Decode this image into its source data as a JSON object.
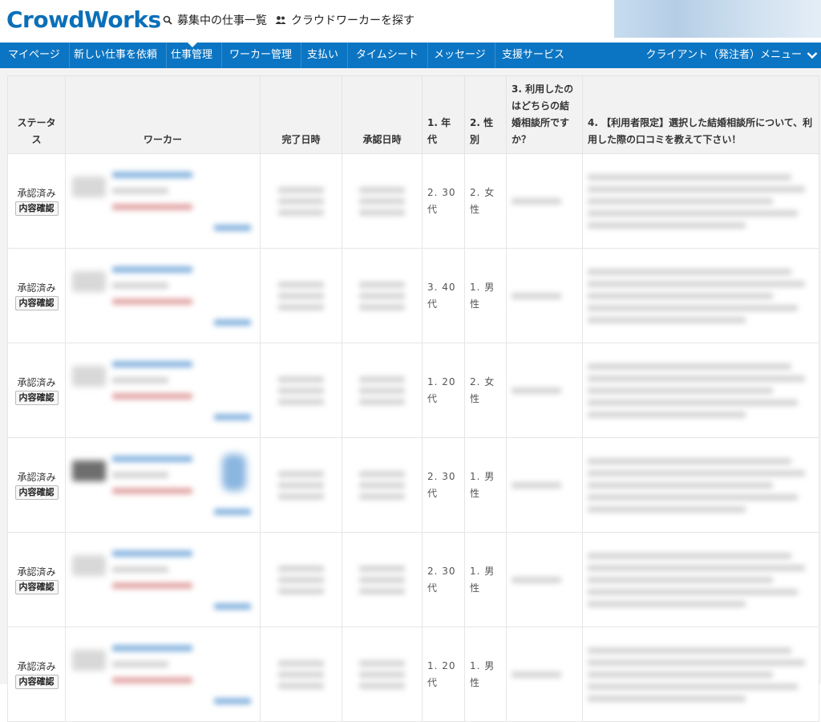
{
  "header": {
    "logo": "CrowdWorks",
    "links": [
      {
        "label": "募集中の仕事一覧",
        "icon": "search-icon"
      },
      {
        "label": "クラウドワーカーを探す",
        "icon": "users-icon"
      }
    ]
  },
  "nav": {
    "items": [
      "マイページ",
      "新しい仕事を依頼",
      "仕事管理",
      "ワーカー管理",
      "支払い",
      "タイムシート",
      "メッセージ",
      "支援サービス"
    ],
    "active": "仕事管理",
    "client_menu": "クライアント（発注者）メニュー"
  },
  "table": {
    "headers": {
      "status": "ステータス",
      "worker": "ワーカー",
      "completed": "完了日時",
      "approved": "承認日時",
      "q1": "1. 年代",
      "q2": "2. 性別",
      "q3": "3. 利用したのはどちらの結婚相談所ですか？",
      "q4": "4. 【利用者限定】選択した結婚相談所について、利用した際の口コミを教えて下さい！"
    },
    "rows": [
      {
        "status": "承認済み",
        "button": "内容確認",
        "q1": "2. 30代",
        "q2": "2. 女性"
      },
      {
        "status": "承認済み",
        "button": "内容確認",
        "q1": "3. 40代",
        "q2": "1. 男性"
      },
      {
        "status": "承認済み",
        "button": "内容確認",
        "q1": "1. 20代",
        "q2": "2. 女性"
      },
      {
        "status": "承認済み",
        "button": "内容確認",
        "q1": "2. 30代",
        "q2": "1. 男性"
      },
      {
        "status": "承認済み",
        "button": "内容確認",
        "q1": "2. 30代",
        "q2": "1. 男性"
      },
      {
        "status": "承認済み",
        "button": "内容確認",
        "q1": "1. 20代",
        "q2": "1. 男性"
      }
    ]
  },
  "colors": {
    "brand": "#0b6fb8",
    "nav": "#0c75c3"
  }
}
